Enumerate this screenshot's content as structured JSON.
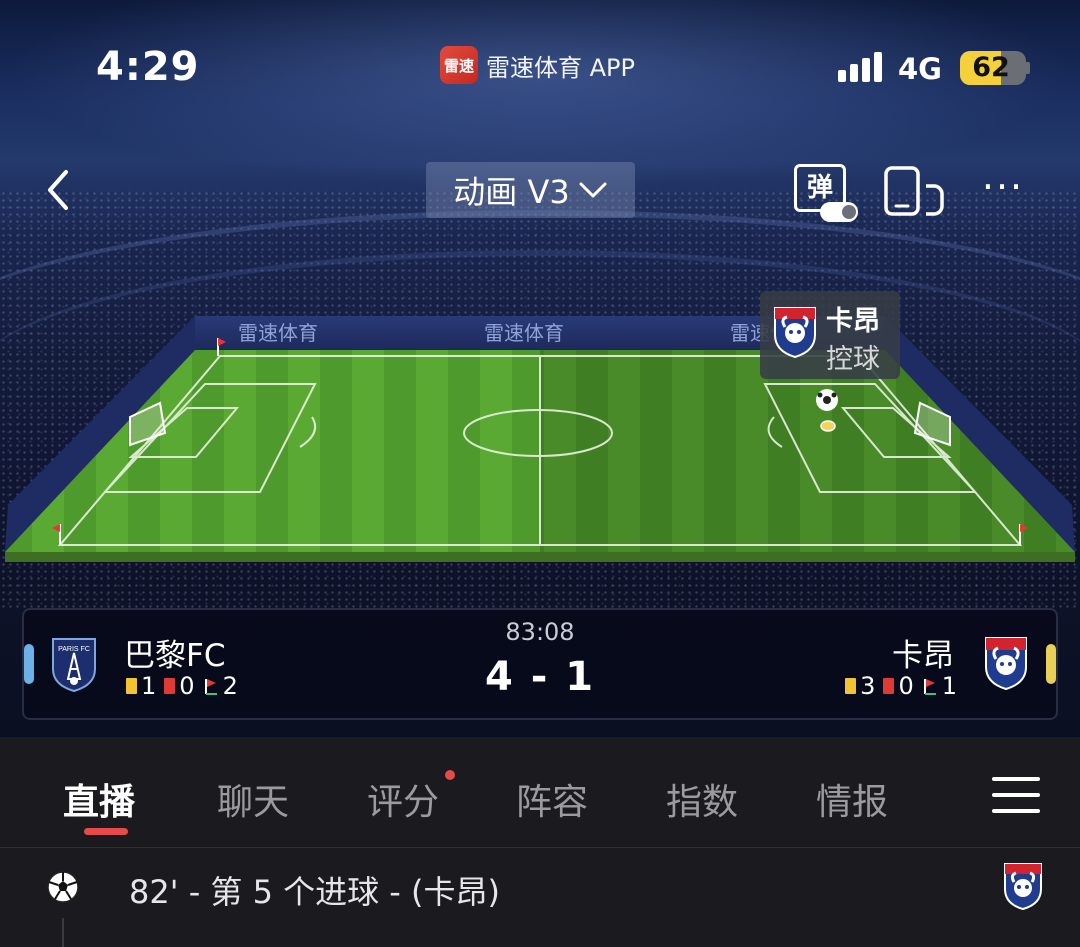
{
  "status_bar": {
    "time": "4:29",
    "app_logo_text": "雷速",
    "app_name": "雷速体育 APP",
    "network": "4G",
    "battery": "62",
    "battery_level": 0.62
  },
  "nav": {
    "back_icon": "chevron-left-icon",
    "mode_label": "动画 V3",
    "danmu_label": "弹",
    "rotate_icon": "rotate-screen-icon",
    "more_label": "···"
  },
  "pitch": {
    "board_text": "雷速体育",
    "possession": {
      "team": "卡昂",
      "label": "控球"
    }
  },
  "match": {
    "time": "83:08",
    "score": "4 - 1",
    "home": {
      "name": "巴黎FC",
      "yellow": "1",
      "red": "0",
      "corners": "2",
      "color": "#6cb2e8"
    },
    "away": {
      "name": "卡昂",
      "yellow": "3",
      "red": "0",
      "corners": "1",
      "color": "#e8cf55"
    }
  },
  "tabs": {
    "items": [
      {
        "label": "直播",
        "active": true
      },
      {
        "label": "聊天"
      },
      {
        "label": "评分",
        "has_dot": true
      },
      {
        "label": "阵容"
      },
      {
        "label": "指数"
      },
      {
        "label": "情报"
      }
    ],
    "menu_icon": "hamburger-menu-icon"
  },
  "feed": {
    "events": [
      {
        "icon": "soccer-ball-icon",
        "text": "82' - 第 5 个进球 - (卡昂)"
      }
    ]
  },
  "colors": {
    "accent": "#e64a4a",
    "yellow_card": "#f2c431",
    "red_card": "#e03a34",
    "background": "#1b1b1f"
  }
}
